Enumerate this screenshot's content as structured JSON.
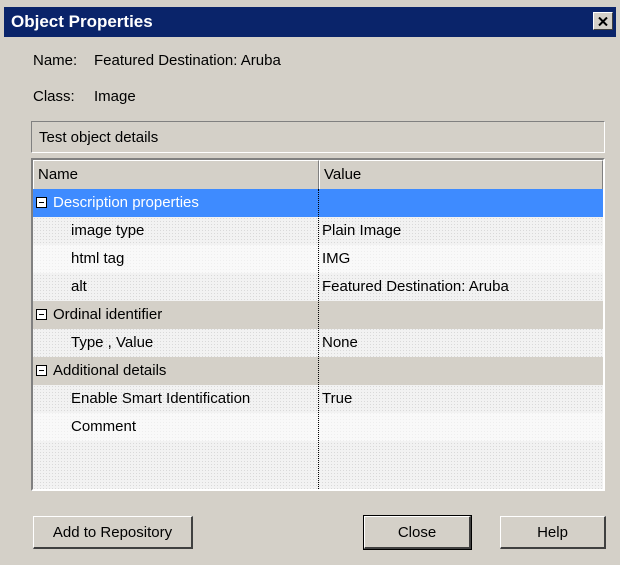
{
  "window": {
    "title": "Object Properties"
  },
  "info": {
    "name_label": "Name:",
    "name_value": "Featured Destination: Aruba",
    "class_label": "Class:",
    "class_value": "Image"
  },
  "details_header": "Test object details",
  "grid": {
    "columns": [
      "Name",
      "Value"
    ],
    "rows": [
      {
        "type": "category",
        "name": "Description properties",
        "value": "",
        "selected": true
      },
      {
        "type": "property",
        "name": "image type",
        "value": "Plain Image"
      },
      {
        "type": "property",
        "name": "html tag",
        "value": "IMG"
      },
      {
        "type": "property",
        "name": "alt",
        "value": "Featured Destination: Aruba"
      },
      {
        "type": "category",
        "name": "Ordinal identifier",
        "value": ""
      },
      {
        "type": "property",
        "name": "Type , Value",
        "value": "None"
      },
      {
        "type": "category",
        "name": "Additional details",
        "value": ""
      },
      {
        "type": "property",
        "name": "Enable Smart Identification",
        "value": "True"
      },
      {
        "type": "property",
        "name": "Comment",
        "value": ""
      }
    ]
  },
  "buttons": {
    "add_to_repository": "Add to Repository",
    "close": "Close",
    "help": "Help"
  }
}
